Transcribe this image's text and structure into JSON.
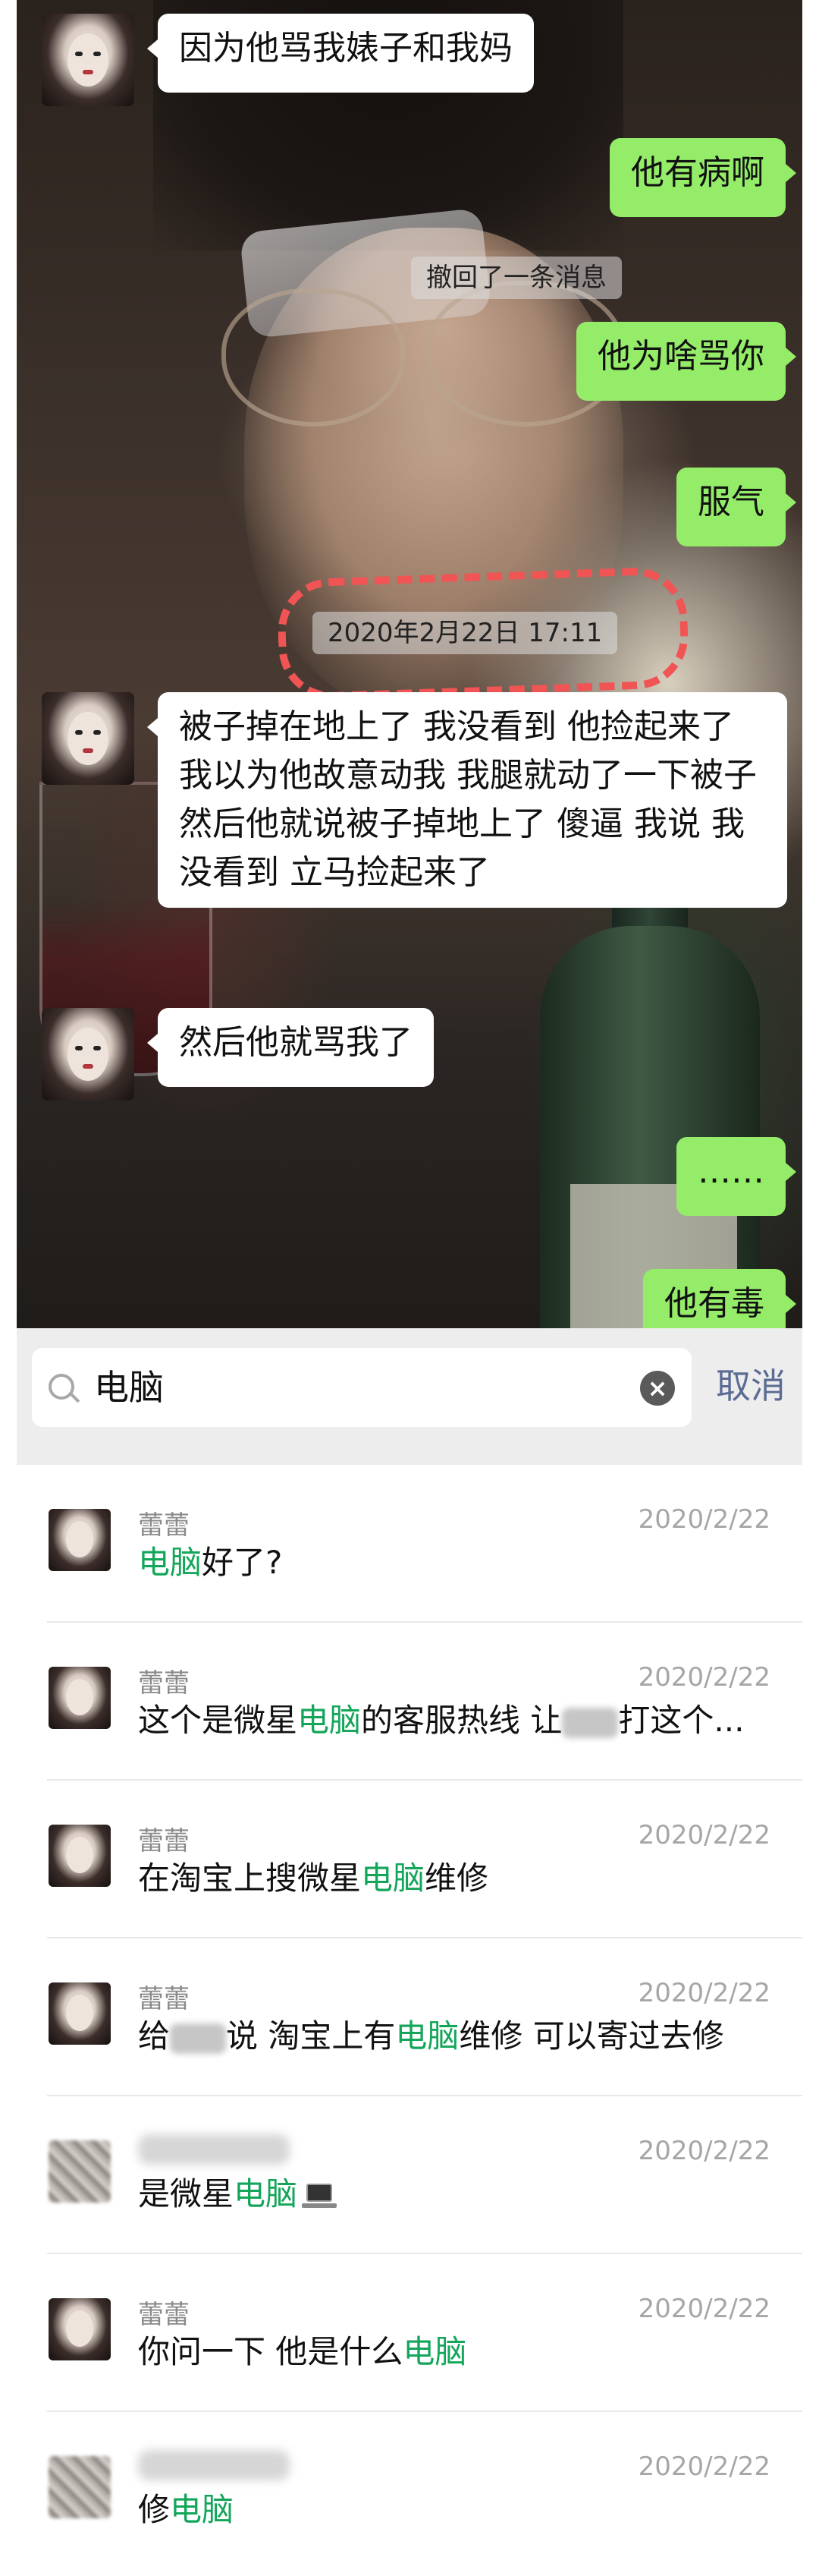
{
  "chat": {
    "messages": [
      {
        "side": "in",
        "text": "因为他骂我婊子和我妈"
      },
      {
        "side": "out",
        "text": "他有病啊"
      },
      {
        "system": "撤回了一条消息"
      },
      {
        "side": "out",
        "text": "他为啥骂你"
      },
      {
        "side": "out",
        "text": "服气"
      },
      {
        "system": "2020年2月22日 17:11"
      },
      {
        "side": "in",
        "text": "被子掉在地上了 我没看到 他捡起来了 我以为他故意动我 我腿就动了一下被子 然后他就说被子掉地上了 傻逼 我说 我没看到 立马捡起来了"
      },
      {
        "side": "in",
        "text": "然后他就骂我了"
      },
      {
        "side": "out",
        "text": "……"
      },
      {
        "side": "out",
        "text": "他有毒"
      }
    ]
  },
  "search": {
    "query": "电脑",
    "cancel_label": "取消",
    "clear_label": "×"
  },
  "results": [
    {
      "name": "蕾蕾",
      "date": "2020/2/22",
      "pre": "",
      "hl": "电脑",
      "post": "好了?"
    },
    {
      "name": "蕾蕾",
      "date": "2020/2/22",
      "pre": "这个是微星",
      "hl": "电脑",
      "post": "的客服热线 让",
      "post2": "打这个..."
    },
    {
      "name": "蕾蕾",
      "date": "2020/2/22",
      "pre": "在淘宝上搜微星",
      "hl": "电脑",
      "post": "维修"
    },
    {
      "name": "蕾蕾",
      "date": "2020/2/22",
      "pre": "给",
      "pre2": "说 淘宝上有",
      "hl": "电脑",
      "post": "维修 可以寄过去修"
    },
    {
      "name": "",
      "date": "2020/2/22",
      "pre": "是微星",
      "hl": "电脑",
      "post": ""
    },
    {
      "name": "蕾蕾",
      "date": "2020/2/22",
      "pre": "你问一下 他是什么",
      "hl": "电脑",
      "post": ""
    },
    {
      "name": "",
      "date": "2020/2/22",
      "pre": "修",
      "hl": "电脑",
      "post": ""
    }
  ],
  "colors": {
    "outgoing_bubble": "#95ec69",
    "highlight": "#13a65a",
    "cancel": "#5b6b93",
    "annotation": "#f05454"
  }
}
